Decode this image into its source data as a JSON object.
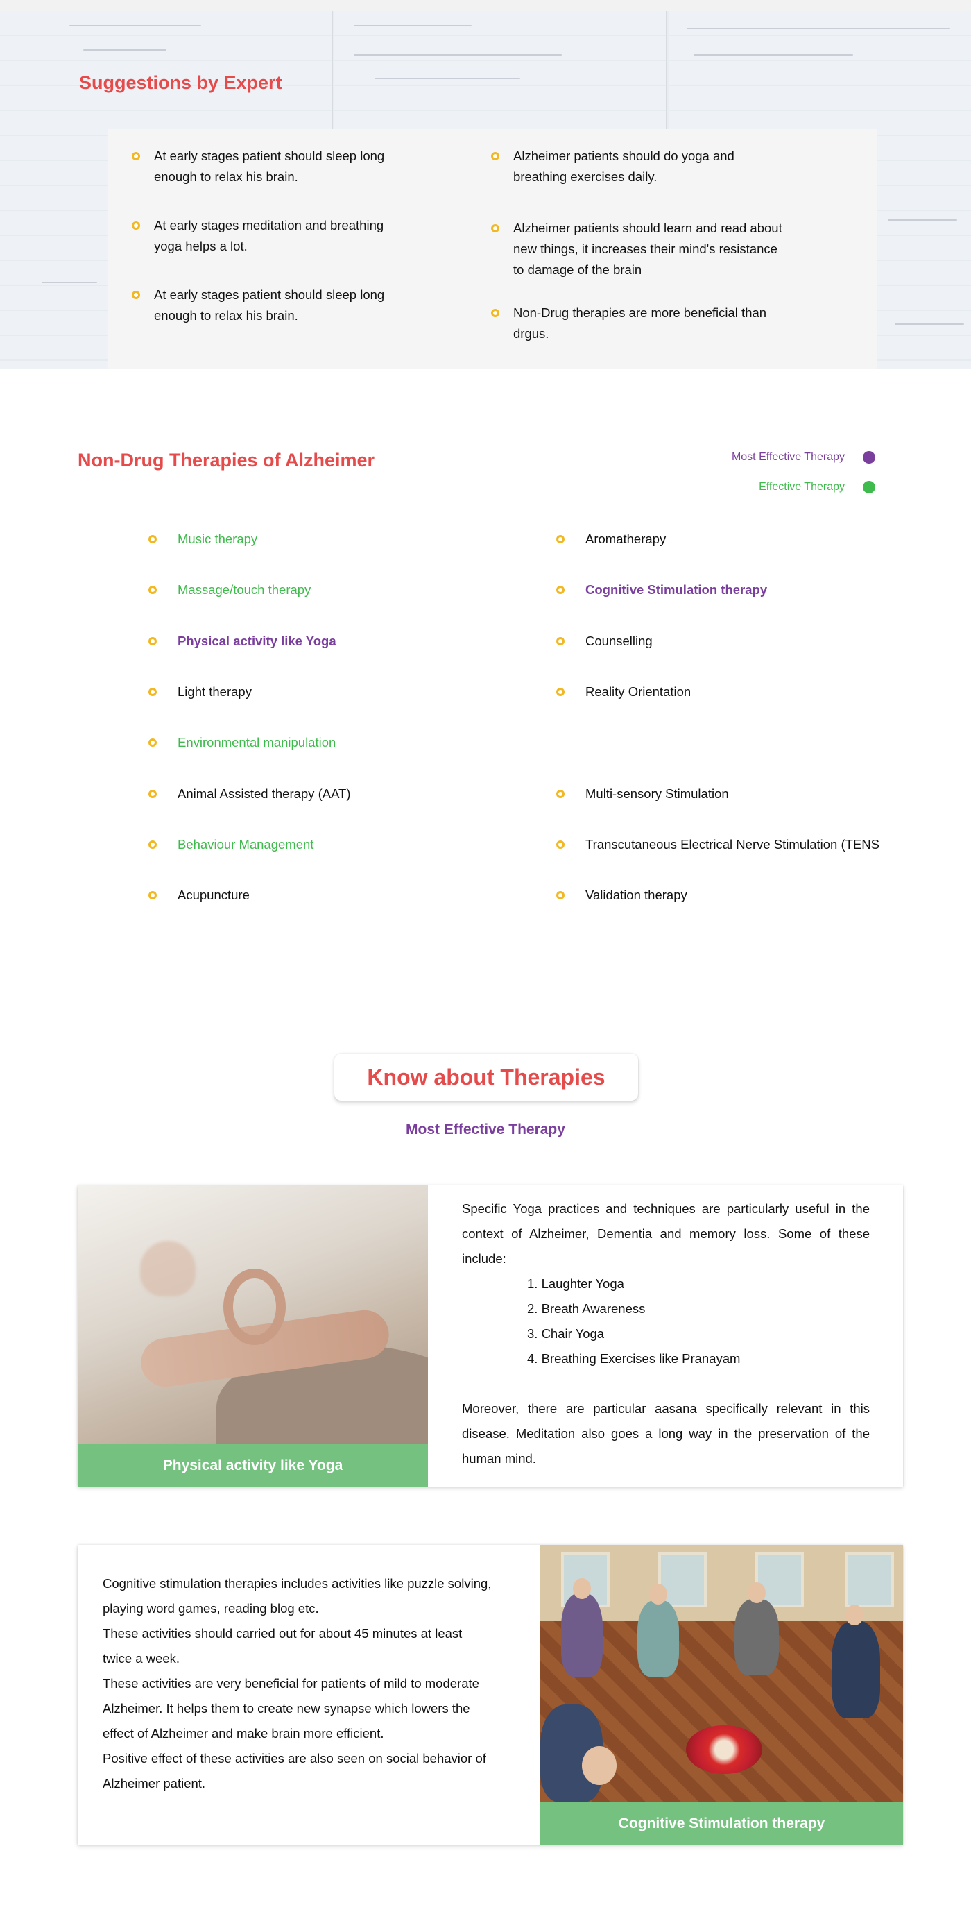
{
  "suggestions": {
    "title": "Suggestions by Expert",
    "left": [
      "At early stages patient should sleep long enough to relax his brain.",
      "At early stages meditation and breathing yoga helps a lot.",
      "At early stages patient should sleep long enough to relax his brain."
    ],
    "right": [
      "Alzheimer patients should do yoga and breathing exercises daily.",
      "Alzheimer patients should learn and read about new things, it increases their mind's resistance to damage of the brain",
      "Non-Drug therapies are more beneficial than drgus."
    ]
  },
  "non_drug": {
    "title": "Non-Drug Therapies of Alzheimer",
    "legend": {
      "most_effective": "Most Effective Therapy",
      "effective": "Effective Therapy"
    },
    "left": [
      {
        "label": "Music therapy",
        "level": "effective"
      },
      {
        "label": "Massage/touch therapy",
        "level": "effective"
      },
      {
        "label": "Physical activity like Yoga",
        "level": "most-effective"
      },
      {
        "label": "Light therapy",
        "level": "normal"
      },
      {
        "label": "Environmental manipulation",
        "level": "effective"
      },
      {
        "label": "Animal Assisted therapy (AAT)",
        "level": "normal"
      },
      {
        "label": "Behaviour Management",
        "level": "effective"
      },
      {
        "label": "Acupuncture",
        "level": "normal"
      }
    ],
    "right": [
      {
        "label": "Aromatherapy",
        "level": "normal"
      },
      {
        "label": "Cognitive Stimulation therapy",
        "level": "most-effective"
      },
      {
        "label": "Counselling",
        "level": "normal"
      },
      {
        "label": "Reality Orientation",
        "level": "normal"
      },
      {
        "label": "Multi-sensory Stimulation",
        "level": "normal"
      },
      {
        "label": "Transcutaneous Electrical Nerve Stimulation (TENS",
        "level": "normal"
      },
      {
        "label": "Validation therapy",
        "level": "normal"
      }
    ]
  },
  "know": {
    "title": "Know about Therapies",
    "subtitle": "Most Effective Therapy"
  },
  "yoga_card": {
    "caption": "Physical activity like Yoga",
    "intro": "Specific Yoga practices and techniques are particularly useful in the context of Alzheimer, Dementia and memory loss. Some of these include:",
    "list": [
      "1. Laughter Yoga",
      "2. Breath Awareness",
      "3. Chair Yoga",
      "4. Breathing Exercises like Pranayam"
    ],
    "outro": "Moreover, there are particular aasana specifically relevant in this disease. Meditation also goes a long way in the preservation of the human mind."
  },
  "cognitive_card": {
    "caption": "Cognitive Stimulation therapy",
    "lines": [
      "Cognitive stimulation therapies includes activities like puzzle solving, playing word games, reading blog etc.",
      "These activities should carried out for about 45 minutes at least twice a week.",
      "These activities are very beneficial for patients of mild to moderate Alzheimer. It helps them to create new synapse which lowers the effect of Alzheimer and make brain more efficient.",
      "Positive effect of these activities are also seen on social behavior of Alzheimer patient."
    ]
  },
  "colors": {
    "heading_red": "#e54b4b",
    "most_effective_purple": "#7a3f9d",
    "effective_green": "#3fba4c",
    "bullet_yellow": "#f2b824",
    "caption_green": "#75c17f"
  }
}
